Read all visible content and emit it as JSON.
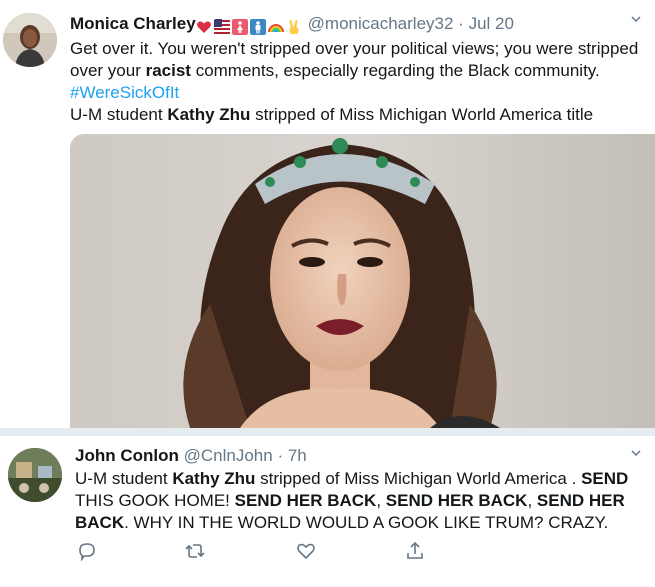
{
  "tweets": [
    {
      "name": "Monica Charley",
      "handle": "@monicacharley32",
      "dot": "·",
      "time": "Jul 20",
      "text_1": "Get over it. You weren't stripped over your political views; you were stripped over your ",
      "text_bold_1": "racist",
      "text_2": " comments, especially regarding the Black community. ",
      "hashtag": "#WereSickOfIt",
      "quote_prefix": "U-M student ",
      "quote_bold": "Kathy Zhu",
      "quote_suffix": " stripped of Miss Michigan World America title",
      "emojis": [
        "red-heart",
        "us-flag",
        "womens-room",
        "mens-room",
        "rainbow",
        "victory-hand"
      ]
    },
    {
      "name": "John Conlon",
      "handle": "@CnlnJohn",
      "dot": "·",
      "time": "7h",
      "seg_1": "U-M student ",
      "seg_2": "Kathy Zhu",
      "seg_3": " stripped of Miss Michigan World America . ",
      "seg_4": "SEND",
      "seg_5": " THIS GOOK HOME! ",
      "seg_6": "SEND HER BACK",
      "seg_7": ", ",
      "seg_8": "SEND HER BACK",
      "seg_9": ", ",
      "seg_10": "SEND HER BACK",
      "seg_11": ". WHY IN THE WORLD WOULD A GOOK LIKE TRUM? CRAZY.",
      "actions": [
        "reply-icon",
        "retweet-icon",
        "like-icon",
        "share-icon"
      ]
    }
  ],
  "colors": {
    "text": "#14171a",
    "secondary": "#657786",
    "link": "#1da1f2",
    "separator": "#e6ecf0"
  }
}
